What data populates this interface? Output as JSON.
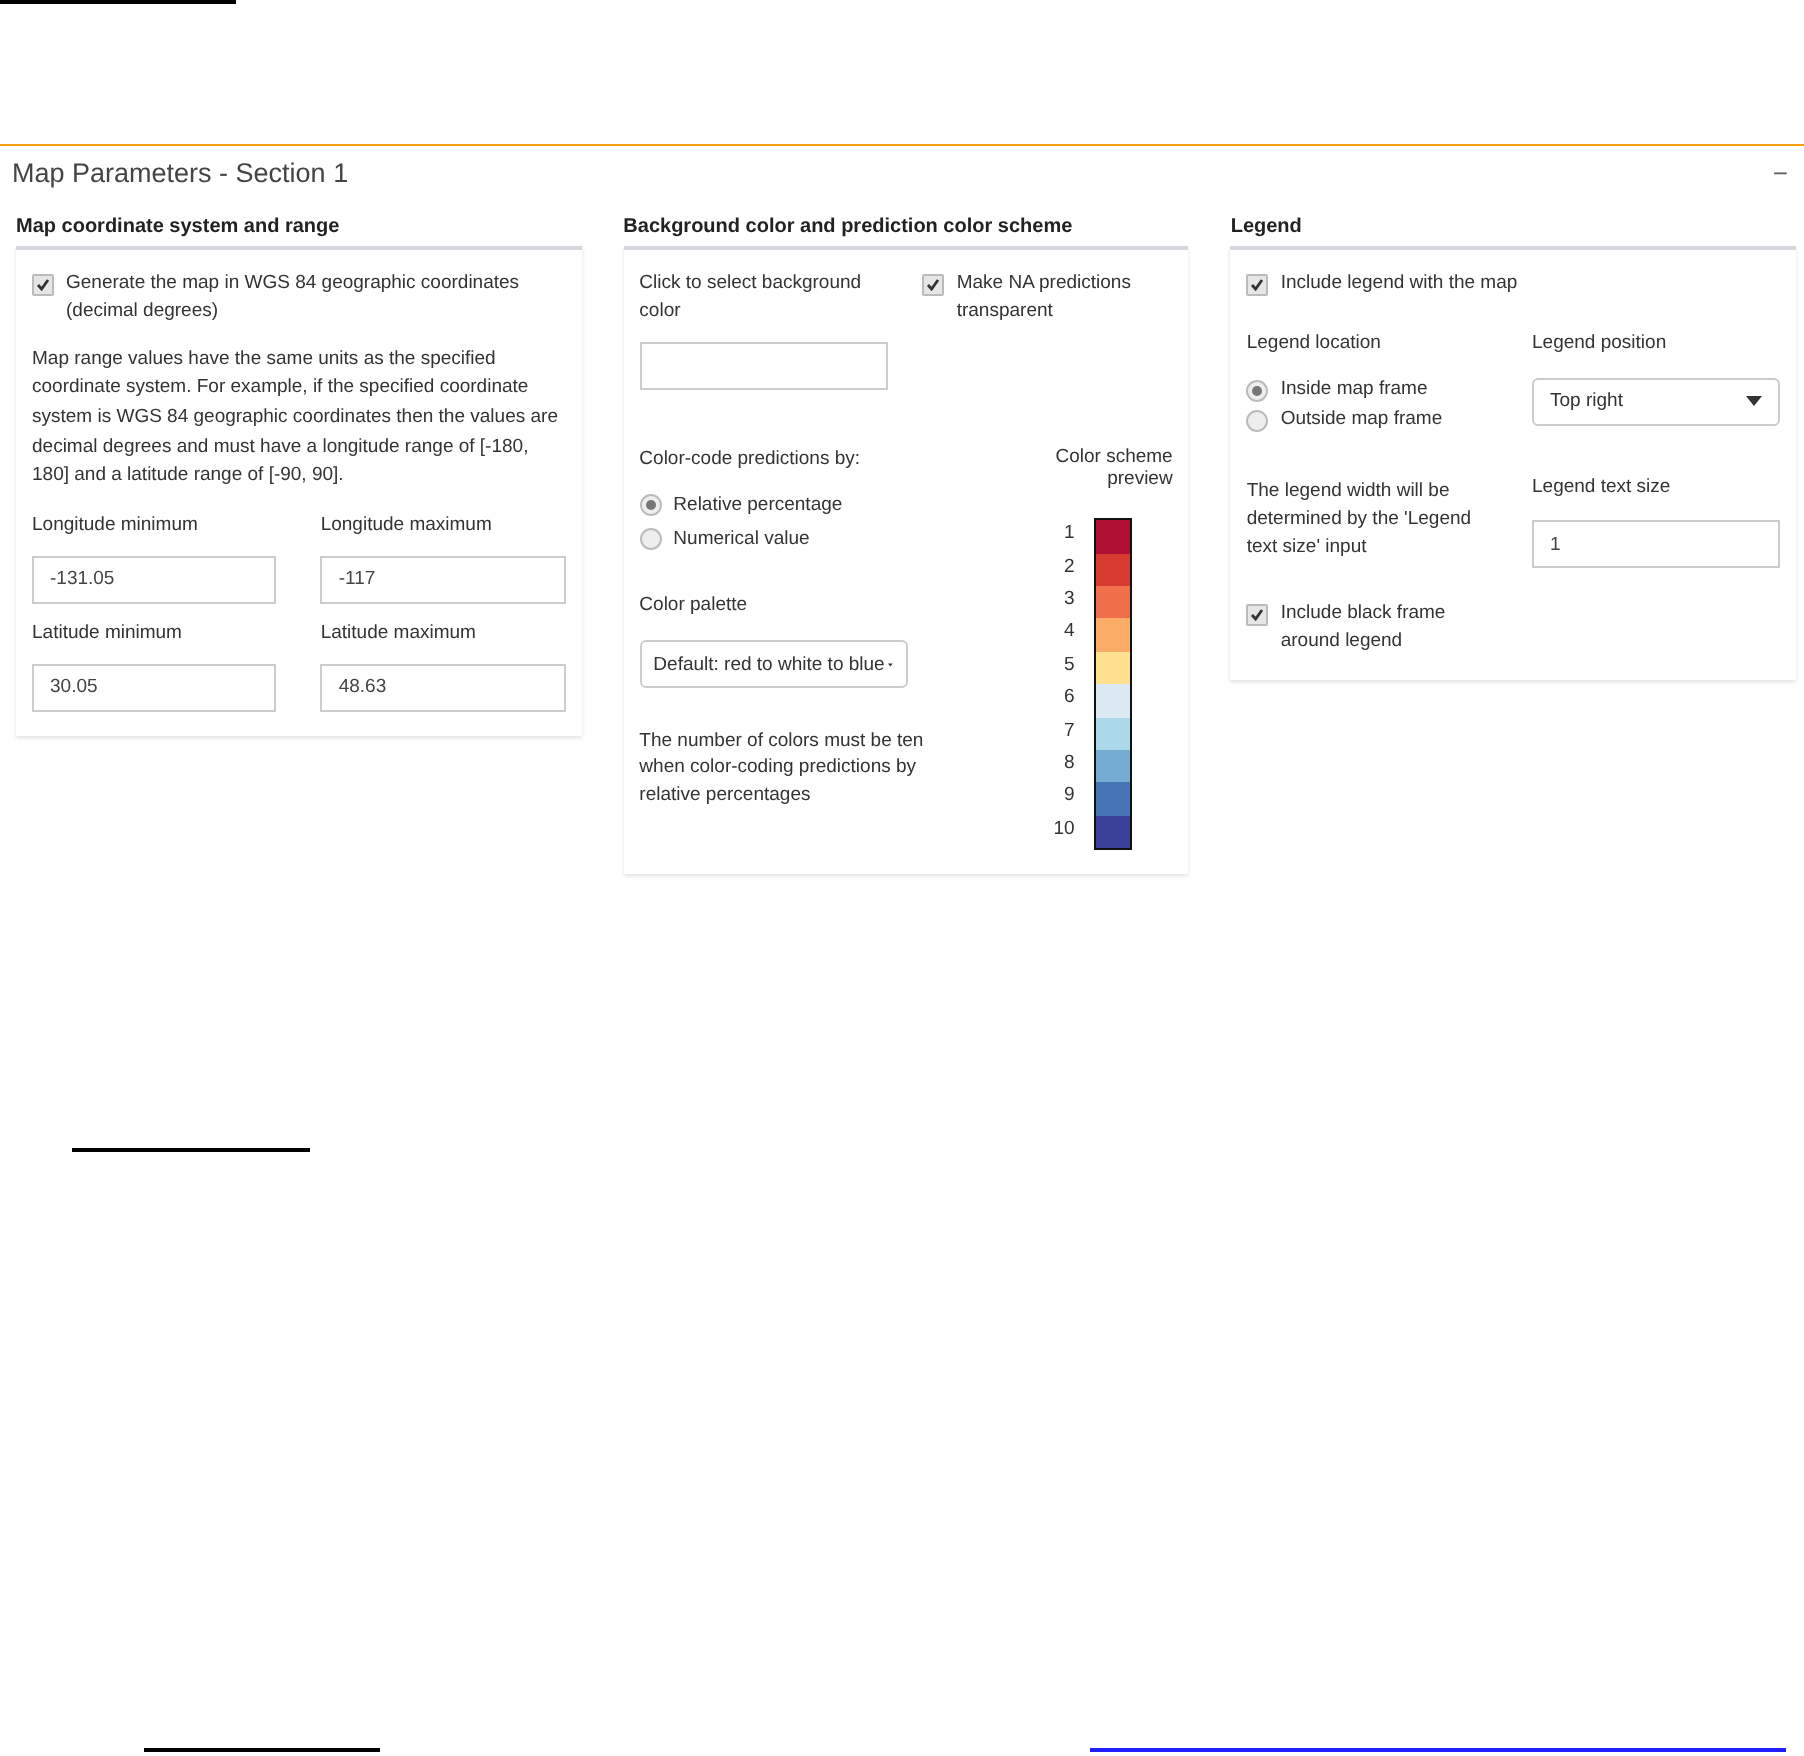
{
  "panel": {
    "title": "Map Parameters - Section 1",
    "collapse_symbol": "−"
  },
  "coordinate_section": {
    "heading": "Map coordinate system and range",
    "wgs84": {
      "label": "Generate the map in WGS 84 geographic coordinates (decimal degrees)",
      "checked": true
    },
    "note": "Map range values have the same units as the specified coordinate system. For example, if the specified coordinate system is WGS 84 geographic coordinates then the values are decimal degrees and must have a longitude range of [-180, 180] and a latitude range of [-90, 90].",
    "fields": [
      {
        "label": "Longitude minimum",
        "value": "-131.05"
      },
      {
        "label": "Longitude maximum",
        "value": "-117"
      },
      {
        "label": "Latitude minimum",
        "value": "30.05"
      },
      {
        "label": "Latitude maximum",
        "value": "48.63"
      }
    ]
  },
  "color_section": {
    "heading": "Background color and prediction color scheme",
    "background_label": "Click to select background color",
    "na_transparent": {
      "label": "Make NA predictions transparent",
      "checked": true
    },
    "color_code_label": "Color-code predictions by:",
    "color_code_options": [
      {
        "label": "Relative percentage",
        "selected": true
      },
      {
        "label": "Numerical value",
        "selected": false
      }
    ],
    "palette_label": "Color palette",
    "palette_value": "Default: red to white to blue",
    "palette_note": "The number of colors must be ten when color-coding predictions by relative percentages",
    "preview_title": "Color scheme preview",
    "scale": [
      {
        "label": "1",
        "color": "#ae1034"
      },
      {
        "label": "2",
        "color": "#d73a2f"
      },
      {
        "label": "3",
        "color": "#ef6f4a"
      },
      {
        "label": "4",
        "color": "#fbad68"
      },
      {
        "label": "5",
        "color": "#fee090"
      },
      {
        "label": "6",
        "color": "#dbe9f3"
      },
      {
        "label": "7",
        "color": "#abd9e9"
      },
      {
        "label": "8",
        "color": "#74add1"
      },
      {
        "label": "9",
        "color": "#4575b4"
      },
      {
        "label": "10",
        "color": "#3a3f98"
      }
    ]
  },
  "legend_section": {
    "heading": "Legend",
    "include": {
      "label": "Include legend with the map",
      "checked": true
    },
    "location_label": "Legend location",
    "location_options": [
      {
        "label": "Inside map frame",
        "selected": true
      },
      {
        "label": "Outside map frame",
        "selected": false
      }
    ],
    "position_label": "Legend position",
    "position_value": "Top right",
    "width_note": "The legend width will be determined by the 'Legend text size' input",
    "text_size_label": "Legend text size",
    "text_size_value": "1",
    "frame": {
      "label": "Include black frame around legend",
      "checked": true
    }
  }
}
